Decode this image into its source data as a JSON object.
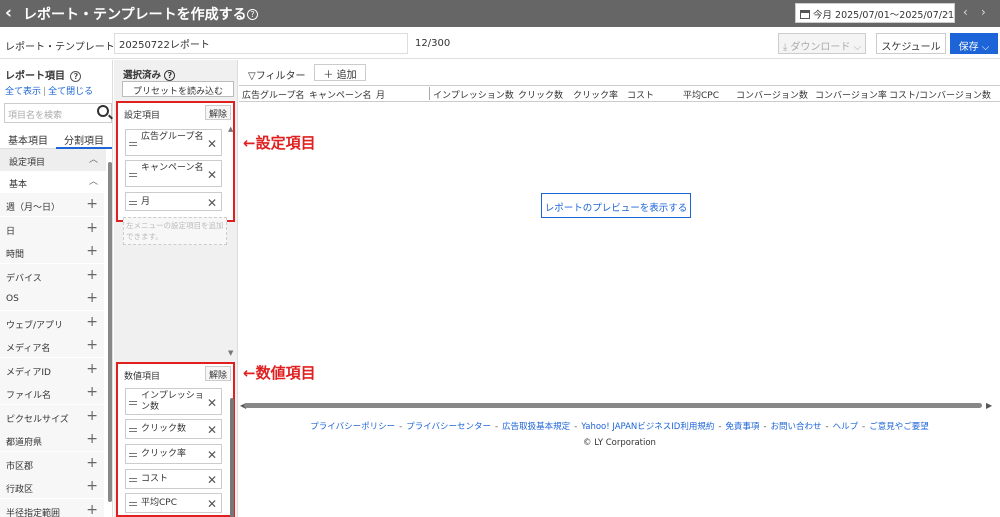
{
  "header": {
    "title": "レポート・テンプレートを作成する",
    "date_range": "今月 2025/07/01～2025/07/21"
  },
  "name_row": {
    "label": "レポート・テンプレート名",
    "value": "20250722レポート",
    "count": "12/300",
    "download_label": "ダウンロード",
    "schedule_label": "スケジュール",
    "save_label": "保存"
  },
  "left_panel": {
    "title": "レポート項目",
    "show_all": "全て表示",
    "close_all": "全て閉じる",
    "search_placeholder": "項目名を検索",
    "tabs": [
      "基本項目",
      "分割項目"
    ],
    "category_settings": "設定項目",
    "category_basic": "基本",
    "items": [
      "週（月～日）",
      "日",
      "時間",
      "デバイス",
      "OS",
      "ウェブ/アプリ",
      "メディア名",
      "メディアID",
      "ファイル名",
      "ピクセルサイズ",
      "都道府県",
      "市区郡",
      "行政区",
      "半径指定範囲"
    ]
  },
  "middle_panel": {
    "title": "選択済み",
    "preset_label": "プリセットを読み込む",
    "settings_box": {
      "title": "設定項目",
      "clear_label": "解除",
      "chips": [
        "広告グループ名",
        "キャンペーン名",
        "月"
      ]
    },
    "drop_hint": "左メニューの設定項目を追加できます。",
    "metrics_box": {
      "title": "数値項目",
      "clear_label": "解除",
      "chips": [
        "インプレッション数",
        "クリック数",
        "クリック率",
        "コスト",
        "平均CPC"
      ]
    }
  },
  "annotations": {
    "settings": "←設定項目",
    "metrics": "←数値項目"
  },
  "table": {
    "filter_label": "フィルター",
    "add_label": "追加",
    "columns": [
      "広告グループ名",
      "キャンペーン名",
      "月",
      "インプレッション数",
      "クリック数",
      "クリック率",
      "コスト",
      "平均CPC",
      "コンバージョン数",
      "コンバージョン率",
      "コスト/コンバージョン数"
    ],
    "preview_label": "レポートのプレビューを表示する"
  },
  "footer": {
    "links": [
      "プライバシーポリシー",
      "プライバシーセンター",
      "広告取扱基本規定",
      "Yahoo! JAPANビジネスID利用規約",
      "免責事項",
      "お問い合わせ",
      "ヘルプ",
      "ご意見やご要望"
    ],
    "copyright": "© LY Corporation"
  },
  "colors": {
    "header_bg": "#666666",
    "accent": "#1c64d8",
    "annotation": "#e02020"
  }
}
